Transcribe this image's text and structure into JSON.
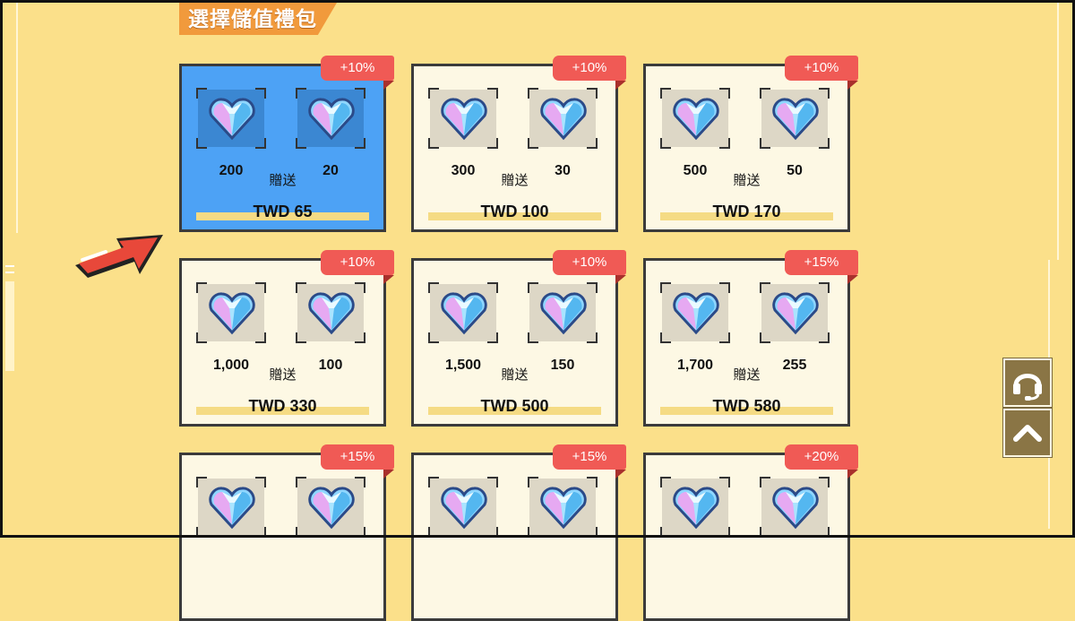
{
  "header": {
    "title": "選擇儲值禮包"
  },
  "packages": [
    {
      "bonus": "+10%",
      "base": "200",
      "gift_label": "贈送",
      "extra": "20",
      "price": "TWD 65",
      "selected": true
    },
    {
      "bonus": "+10%",
      "base": "300",
      "gift_label": "贈送",
      "extra": "30",
      "price": "TWD 100"
    },
    {
      "bonus": "+10%",
      "base": "500",
      "gift_label": "贈送",
      "extra": "50",
      "price": "TWD 170"
    },
    {
      "bonus": "+10%",
      "base": "1,000",
      "gift_label": "贈送",
      "extra": "100",
      "price": "TWD 330"
    },
    {
      "bonus": "+10%",
      "base": "1,500",
      "gift_label": "贈送",
      "extra": "150",
      "price": "TWD 500"
    },
    {
      "bonus": "+15%",
      "base": "1,700",
      "gift_label": "贈送",
      "extra": "255",
      "price": "TWD 580"
    },
    {
      "bonus": "+15%"
    },
    {
      "bonus": "+15%"
    },
    {
      "bonus": "+20%"
    }
  ],
  "icons": {
    "gem": "heart-diamond-icon",
    "pointer": "arrow-pointer-icon",
    "support": "headset-icon",
    "scroll_top": "chevron-up-icon"
  },
  "colors": {
    "page_bg": "#fbe08a",
    "selected_card": "#4da2f5",
    "card_bg": "#fdf8e4",
    "bonus_badge": "#f05a55",
    "header_tab": "#f19a3c",
    "side_button": "#8a7545",
    "pointer": "#e8483a"
  }
}
